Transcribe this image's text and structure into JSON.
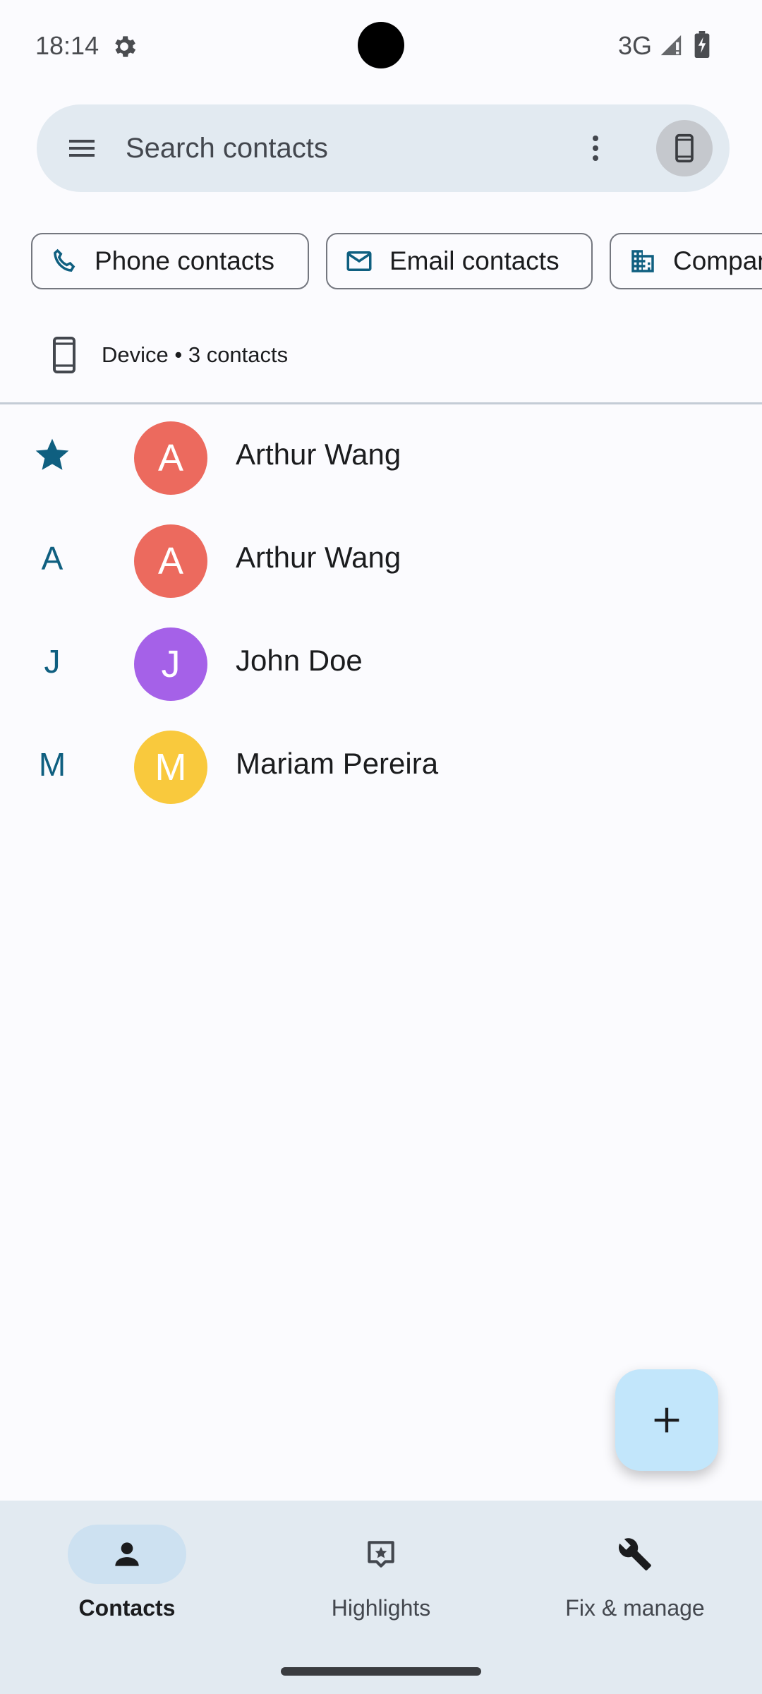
{
  "status_bar": {
    "time": "18:14",
    "network": "3G",
    "icons": [
      "settings-gear-icon",
      "signal-icon",
      "battery-charging-icon"
    ]
  },
  "search": {
    "placeholder": "Search contacts",
    "icons": [
      "menu-icon",
      "more-vert-icon",
      "phone-device-icon"
    ]
  },
  "filter_chips": [
    {
      "label": "Phone contacts",
      "icon": "phone-icon"
    },
    {
      "label": "Email contacts",
      "icon": "email-icon"
    },
    {
      "label": "Companies",
      "icon": "business-icon"
    }
  ],
  "account": {
    "label": "Device • 3 contacts",
    "icon": "phone-device-icon"
  },
  "contacts": [
    {
      "index": "",
      "index_icon": "star-icon",
      "initial": "A",
      "name": "Arthur Wang",
      "color": "#ec6a5e"
    },
    {
      "index": "A",
      "initial": "A",
      "name": "Arthur Wang",
      "color": "#ec6a5e"
    },
    {
      "index": "J",
      "initial": "J",
      "name": "John Doe",
      "color": "#a561e8"
    },
    {
      "index": "M",
      "initial": "M",
      "name": "Mariam Pereira",
      "color": "#f9c93d"
    }
  ],
  "fab": {
    "icon": "add-icon"
  },
  "bottom_nav": [
    {
      "label": "Contacts",
      "icon": "person-icon",
      "active": true
    },
    {
      "label": "Highlights",
      "icon": "highlights-icon",
      "active": false
    },
    {
      "label": "Fix & manage",
      "icon": "wrench-icon",
      "active": false
    }
  ],
  "colors": {
    "background": "#fbfbfe",
    "surface": "#e2eaf1",
    "accent": "#0f5f80",
    "fab": "#c2e6fb",
    "nav_active_pill": "#cde1f1"
  }
}
